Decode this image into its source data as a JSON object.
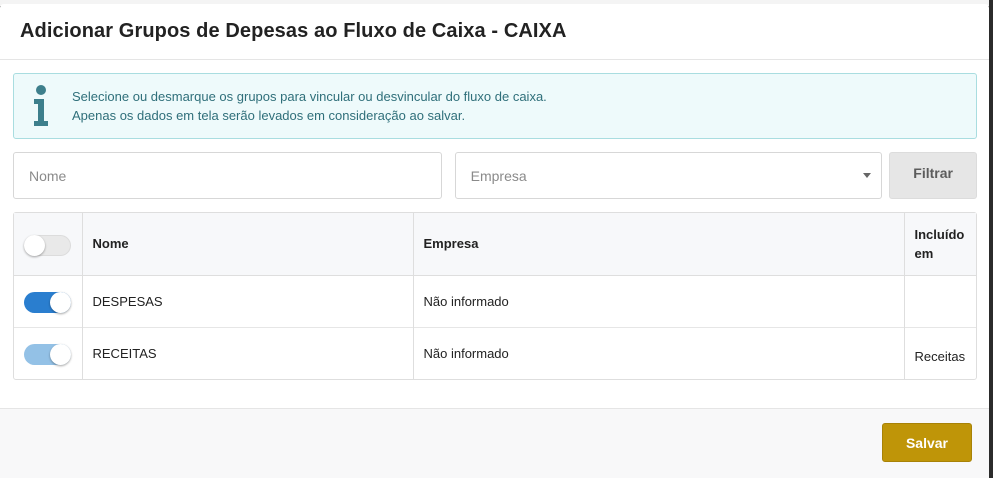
{
  "modal": {
    "title": "Adicionar Grupos de Depesas ao Fluxo de Caixa - CAIXA"
  },
  "alert": {
    "icon": "info-icon",
    "line1": "Selecione ou desmarque os grupos para vincular ou desvincular do fluxo de caixa.",
    "line2": "Apenas os dados em tela serão levados em consideração ao salvar."
  },
  "filters": {
    "nome_placeholder": "Nome",
    "nome_value": "",
    "empresa_placeholder": "Empresa",
    "filtrar_label": "Filtrar"
  },
  "table": {
    "headers": {
      "nome": "Nome",
      "empresa": "Empresa",
      "incluido": "Incluído em"
    },
    "select_all": false,
    "rows": [
      {
        "selected": true,
        "disabled": false,
        "nome": "DESPESAS",
        "empresa": "Não informado",
        "incluido": ""
      },
      {
        "selected": true,
        "disabled": true,
        "nome": "RECEITAS",
        "empresa": "Não informado",
        "incluido": "Receitas"
      }
    ]
  },
  "footer": {
    "save_label": "Salvar"
  },
  "colors": {
    "accent_save": "#bf9508",
    "toggle_on": "#2a7ecf",
    "toggle_disabled": "#93c1e6",
    "alert_bg": "#eefafb",
    "alert_text": "#2f6f7a"
  }
}
